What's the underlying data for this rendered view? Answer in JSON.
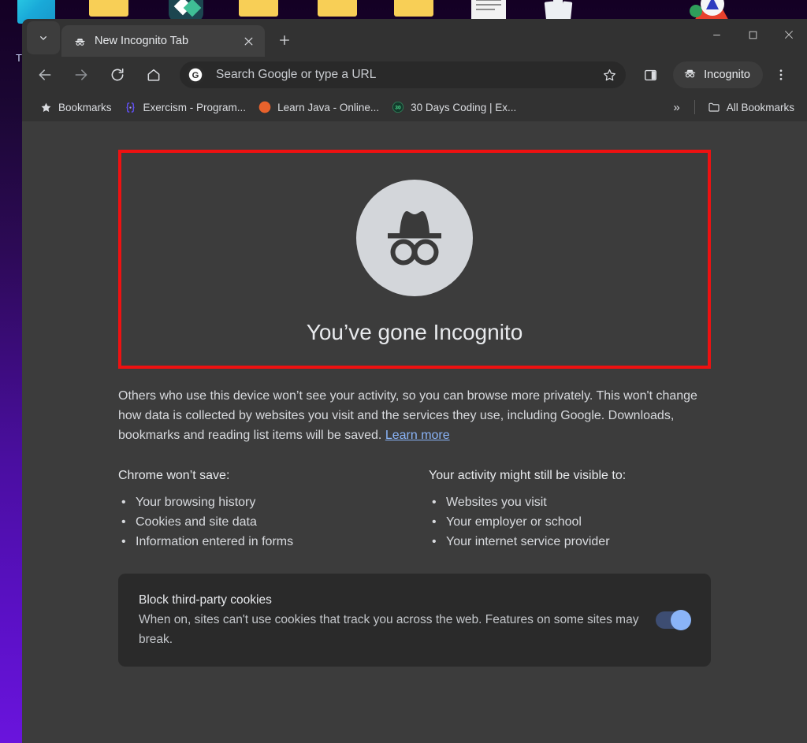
{
  "desktop": {
    "icons": [
      {
        "name": "app-tile-cyan",
        "label": "T"
      },
      {
        "name": "folder-1",
        "label": ""
      },
      {
        "name": "app-tile-teal",
        "label": ""
      },
      {
        "name": "folder-2",
        "label": ""
      },
      {
        "name": "folder-3",
        "label": ""
      },
      {
        "name": "folder-4",
        "label": ""
      },
      {
        "name": "document-file",
        "label": ""
      },
      {
        "name": "papers-file",
        "label": ""
      },
      {
        "name": "vlc-media-player",
        "label": ""
      }
    ]
  },
  "window": {
    "tab": {
      "title": "New Incognito Tab",
      "favicon": "incognito-icon",
      "close_label": "×",
      "newtab_label": "+"
    },
    "tab_search_icon": "chevron-down-icon",
    "controls": {
      "minimize": "minimize-icon",
      "maximize": "maximize-icon",
      "close": "close-icon"
    }
  },
  "toolbar": {
    "back": "back-arrow-icon",
    "forward": "forward-arrow-icon",
    "reload": "reload-icon",
    "home": "home-icon",
    "search_engine_icon": "google-g-icon",
    "omnibox_placeholder": "Search Google or type a URL",
    "omnibox_value": "",
    "bookmark_star": "star-icon",
    "side_panel": "side-panel-icon",
    "profile_label": "Incognito",
    "profile_icon": "incognito-icon",
    "menu": "three-dot-menu-icon"
  },
  "bookmarks_bar": {
    "items": [
      {
        "label": "Bookmarks",
        "icon": "star-icon"
      },
      {
        "label": "Exercism - Program...",
        "icon": "exercism-favicon"
      },
      {
        "label": "Learn Java - Online...",
        "icon": "learn-java-favicon"
      },
      {
        "label": "30 Days Coding | Ex...",
        "icon": "thirty-days-coding-favicon"
      }
    ],
    "overflow_label": "»",
    "all_bookmarks_label": "All Bookmarks",
    "all_bookmarks_icon": "folder-icon"
  },
  "ntp": {
    "heading": "You’ve gone Incognito",
    "hero_icon": "incognito-avatar-icon",
    "intro_text": "Others who use this device won’t see your activity, so you can browse more privately. This won't change how data is collected by websites you visit and the services they use, including Google. Downloads, bookmarks and reading list items will be saved. ",
    "learn_more_label": "Learn more",
    "columns": [
      {
        "heading": "Chrome won’t save:",
        "items": [
          "Your browsing history",
          "Cookies and site data",
          "Information entered in forms"
        ]
      },
      {
        "heading": "Your activity might still be visible to:",
        "items": [
          "Websites you visit",
          "Your employer or school",
          "Your internet service provider"
        ]
      }
    ],
    "cookie_card": {
      "title": "Block third-party cookies",
      "description": "When on, sites can't use cookies that track you across the web. Features on some sites may break.",
      "toggle_state": "on"
    }
  },
  "colors": {
    "accent_link": "#8ab4f8",
    "toggle_on": "#8ab4f8",
    "highlight_box": "#ee1111",
    "page_bg": "#3c3c3c",
    "chrome_bg": "#323232"
  }
}
